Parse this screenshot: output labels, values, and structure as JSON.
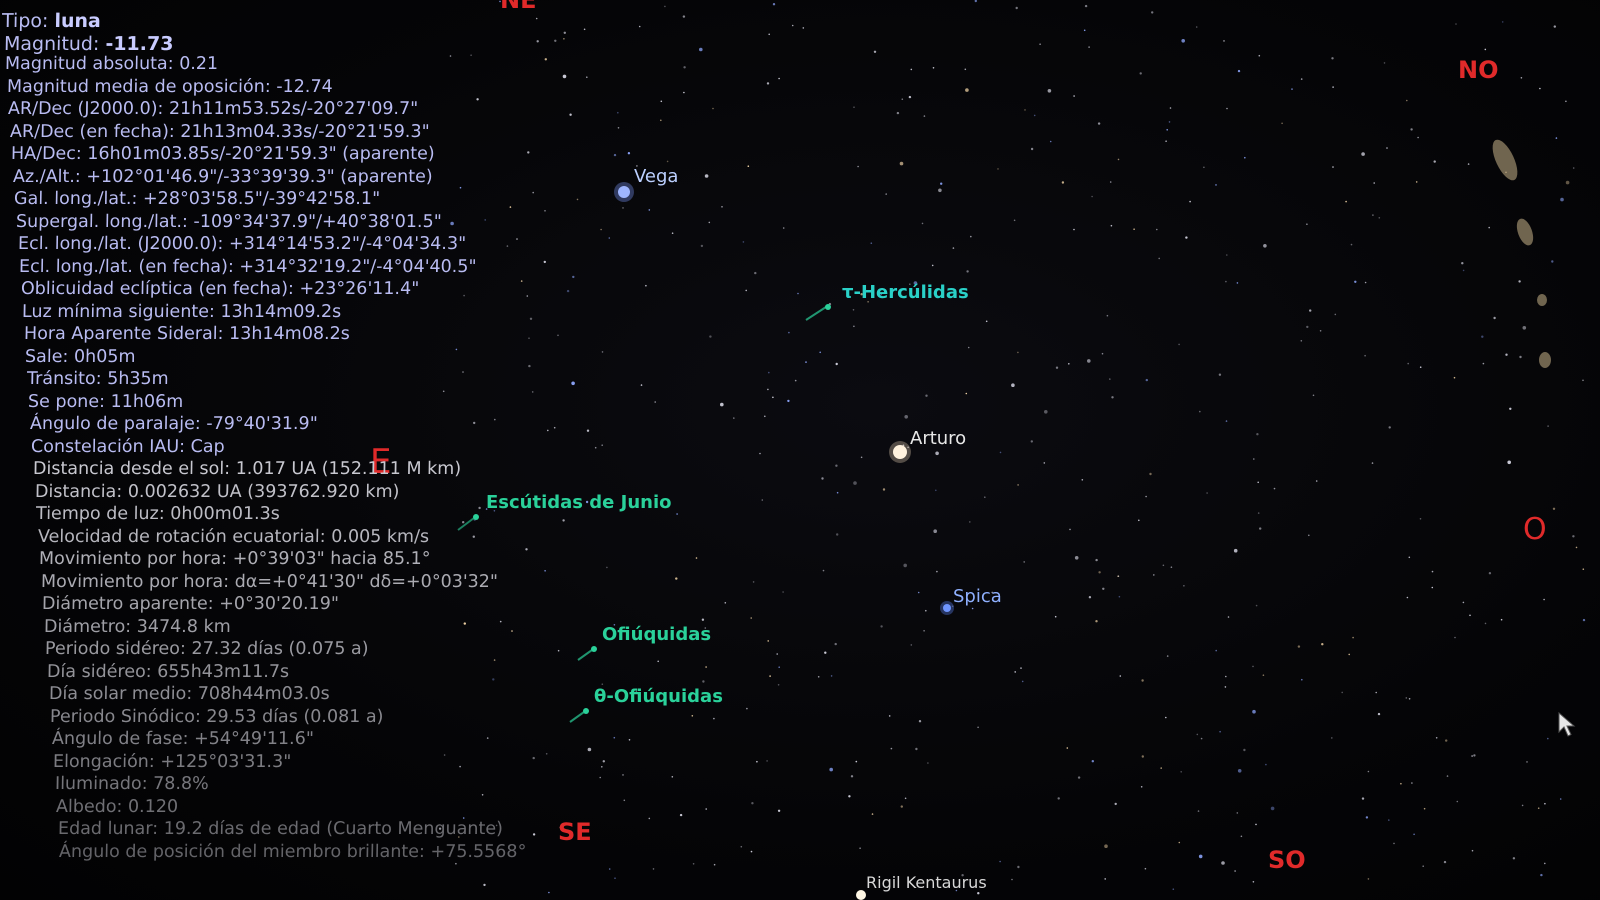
{
  "info_panel": {
    "lines": [
      {
        "label": "Tipo:",
        "value": "luna"
      },
      {
        "label": "Magnitud:",
        "value": "-11.73"
      },
      {
        "label": "Magnitud absoluta:",
        "value": "0.21"
      },
      {
        "label": "Magnitud media de oposición:",
        "value": "-12.74"
      },
      {
        "label": "AR/Dec (J2000.0):",
        "value": "21h11m53.52s/-20°27'09.7\""
      },
      {
        "label": "AR/Dec (en fecha):",
        "value": "21h13m04.33s/-20°21'59.3\""
      },
      {
        "label": "HA/Dec:",
        "value": "16h01m03.85s/-20°21'59.3\" (aparente)"
      },
      {
        "label": "Az./Alt.:",
        "value": "+102°01'46.9\"/-33°39'39.3\" (aparente)"
      },
      {
        "label": "Gal. long./lat.:",
        "value": "+28°03'58.5\"/-39°42'58.1\""
      },
      {
        "label": "Supergal. long./lat.:",
        "value": "-109°34'37.9\"/+40°38'01.5\""
      },
      {
        "label": "Ecl. long./lat. (J2000.0):",
        "value": "+314°14'53.2\"/-4°04'34.3\""
      },
      {
        "label": "Ecl. long./lat. (en fecha):",
        "value": "+314°32'19.2\"/-4°04'40.5\""
      },
      {
        "label": "Oblicuidad eclíptica (en fecha):",
        "value": "+23°26'11.4\""
      },
      {
        "label": "Luz mínima siguiente:",
        "value": "13h14m09.2s"
      },
      {
        "label": "Hora Aparente Sideral:",
        "value": "13h14m08.2s"
      },
      {
        "label": "Sale:",
        "value": "0h05m"
      },
      {
        "label": "Tránsito:",
        "value": "5h35m"
      },
      {
        "label": "Se pone:",
        "value": "11h06m"
      },
      {
        "label": "Ángulo de paralaje:",
        "value": "-79°40'31.9\""
      },
      {
        "label": "Constelación IAU:",
        "value": "Cap"
      },
      {
        "label": "Distancia desde el sol:",
        "value": "1.017 UA (152.111 M km)"
      },
      {
        "label": "Distancia:",
        "value": "0.002632 UA (393762.920 km)"
      },
      {
        "label": "Tiempo de luz:",
        "value": "0h00m01.3s"
      },
      {
        "label": "Velocidad de rotación ecuatorial:",
        "value": "0.005 km/s"
      },
      {
        "label": "Movimiento por hora:",
        "value": "+0°39'03\" hacia 85.1°"
      },
      {
        "label": "Movimiento por hora:",
        "value": "dα=+0°41'30\" dδ=+0°03'32\""
      },
      {
        "label": "Diámetro aparente:",
        "value": "+0°30'20.19\""
      },
      {
        "label": "Diámetro:",
        "value": "3474.8 km"
      },
      {
        "label": "Periodo sidéreo:",
        "value": "27.32 días (0.075 a)"
      },
      {
        "label": "Día sidéreo:",
        "value": "655h43m11.7s"
      },
      {
        "label": "Día solar medio:",
        "value": "708h44m03.0s"
      },
      {
        "label": "Periodo Sinódico:",
        "value": "29.53 días (0.081 a)"
      },
      {
        "label": "Ángulo de fase:",
        "value": "+54°49'11.6\""
      },
      {
        "label": "Elongación:",
        "value": "+125°03'31.3\""
      },
      {
        "label": "Iluminado:",
        "value": "78.8%"
      },
      {
        "label": "Albedo:",
        "value": "0.120"
      },
      {
        "label": "Edad lunar:",
        "value": "19.2 días de edad (Cuarto Menguante)"
      },
      {
        "label": "Ángulo de posición del miembro brillante:",
        "value": "+75.5568°"
      }
    ]
  },
  "cardinals": {
    "ne": "NE",
    "e": "E",
    "se": "SE",
    "so": "SO",
    "o": "O",
    "no": "NO"
  },
  "labels": {
    "vega": "Vega",
    "arturo": "Arturo",
    "spica": "Spica",
    "rigil": "Rigil Kentaurus",
    "tau_herculids": "τ-Hercúlidas",
    "scutids": "Escútidas de Junio",
    "ophiuchids": "Ofiúquidas",
    "theta_ophiuchids": "θ-Ofiúquidas"
  },
  "colors": {
    "cardinal": "#e02a2a",
    "meteor_label": "#2ad19a",
    "star_label": "#e8e8e8",
    "info_text": "#b9bcf2"
  }
}
